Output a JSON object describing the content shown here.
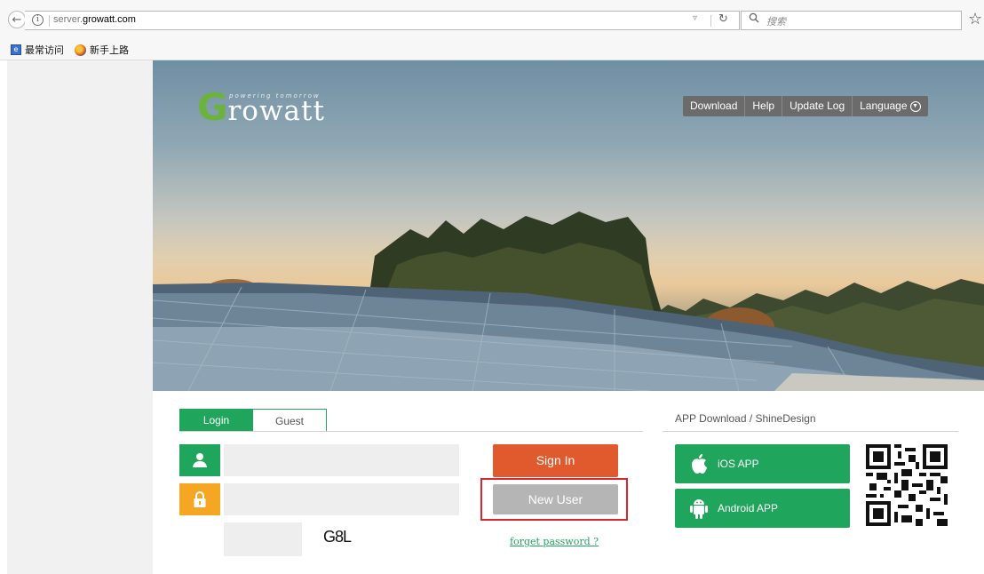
{
  "browser": {
    "url_prefix": "server.",
    "url_domain": "growatt.com",
    "search_placeholder": "搜索",
    "bookmarks": [
      {
        "label": "最常访问",
        "icon": "bookmark-page-icon"
      },
      {
        "label": "新手上路",
        "icon": "firefox-icon"
      }
    ]
  },
  "brand": {
    "logo_letter": "G",
    "logo_rest": "rowatt",
    "tagline": "powering tomorrow",
    "accent_green": "#1fa55c",
    "accent_orange": "#e05a2d"
  },
  "nav": {
    "items": [
      "Download",
      "Help",
      "Update Log",
      "Language"
    ]
  },
  "login": {
    "tabs": [
      "Login",
      "Guest"
    ],
    "username_value": "",
    "password_value": "",
    "captcha_value": "",
    "captcha_text": "G8L",
    "sign_in_label": "Sign In",
    "new_user_label": "New User",
    "forget_label": "forget password ?"
  },
  "app": {
    "header": "APP Download  /  ShineDesign",
    "ios_label": "iOS APP",
    "android_label": "Android APP"
  }
}
